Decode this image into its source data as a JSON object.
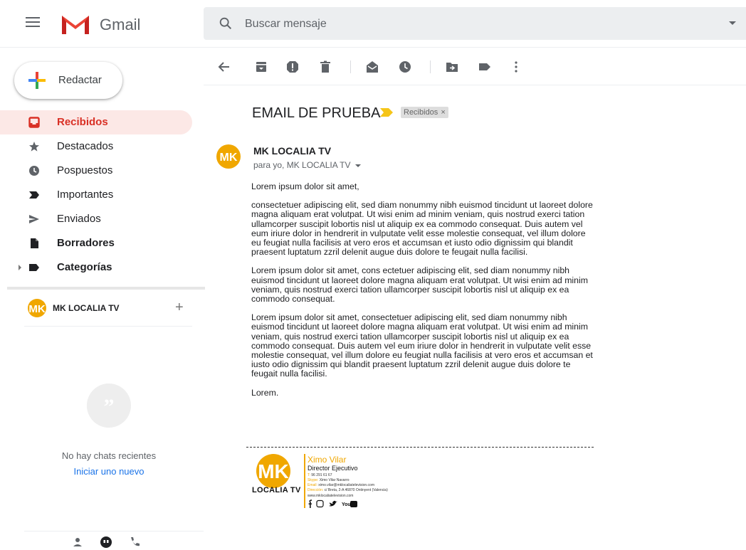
{
  "app": {
    "name": "Gmail"
  },
  "search": {
    "placeholder": "Buscar mensaje"
  },
  "compose": {
    "label": "Redactar"
  },
  "nav": [
    {
      "label": "Recibidos",
      "icon": "inbox-icon",
      "active": true
    },
    {
      "label": "Destacados",
      "icon": "star-icon"
    },
    {
      "label": "Pospuestos",
      "icon": "clock-icon"
    },
    {
      "label": "Importantes",
      "icon": "important-icon"
    },
    {
      "label": "Enviados",
      "icon": "send-icon"
    },
    {
      "label": "Borradores",
      "icon": "draft-icon"
    },
    {
      "label": "Categorías",
      "icon": "label-icon"
    }
  ],
  "account": {
    "name": "MK LOCALIA TV",
    "add": "+"
  },
  "chats": {
    "empty": "No hay chats recientes",
    "start": "Iniciar uno nuevo"
  },
  "toolbar": {
    "icons": [
      "back-arrow-icon",
      "archive-icon",
      "report-spam-icon",
      "delete-icon",
      "mark-unread-icon",
      "snooze-icon",
      "move-to-icon",
      "labels-icon",
      "more-icon"
    ]
  },
  "email": {
    "subject": "EMAIL DE PRUEBA",
    "label_chip": "Recibidos",
    "label_chip_close": "×",
    "sender": "MK LOCALIA TV",
    "recipient": "para yo, MK LOCALIA TV",
    "greeting": "Lorem ipsum dolor sit amet,",
    "para1": "consectetuer adipiscing elit, sed diam nonummy nibh euismod tincidunt ut laoreet dolore magna aliquam erat volutpat. Ut wisi enim ad minim veniam, quis nostrud exerci tation ullamcorper suscipit lobortis nisl ut aliquip ex ea commodo consequat. Duis autem vel eum iriure dolor in hendrerit in vulputate velit esse molestie consequat, vel illum dolore eu feugiat nulla facilisis at vero eros et accumsan et iusto odio dignissim qui blandit praesent luptatum zzril delenit augue duis dolore te feugait nulla facilisi.",
    "para2": "Lorem ipsum dolor sit amet, cons ectetuer adipiscing elit, sed diam nonummy nibh euismod tincidunt ut laoreet dolore magna aliquam erat volutpat. Ut wisi enim ad minim veniam, quis nostrud exerci tation ullamcorper suscipit lobortis nisl ut aliquip ex ea commodo consequat.",
    "para3": "Lorem ipsum dolor sit amet, consectetuer adipiscing elit, sed diam nonummy nibh euismod tincidunt ut laoreet dolore magna aliquam erat volutpat. Ut wisi enim ad minim veniam, quis nostrud exerci tation ullamcorper suscipit lobortis nisl ut aliquip ex ea commodo consequat. Duis autem vel eum iriure dolor in hendrerit in vulputate velit esse molestie consequat, vel illum dolore eu feugiat nulla facilisis at vero eros et accumsan et iusto odio dignissim qui blandit praesent luptatum zzril delenit augue duis dolore te feugait nulla facilisi.",
    "closing": "Lorem."
  },
  "signature": {
    "logo_text": "LOCALIA TV",
    "name": "Ximo Vilar",
    "role": "Director Ejecutivo",
    "phone_key": "T:",
    "phone": "96 291 61 67",
    "skype_key": "Skype:",
    "skype": "Ximo Vilar Navarro",
    "email_key": "Email:",
    "email": "ximo.vilar@mklocaliatelevision.com",
    "address_key": "Dirección:",
    "address": "c/ Breta, 2-A 46870 Ontinyent (Valencia)",
    "website": "www.mklocaliatelevision.com"
  },
  "colors": {
    "accent_red": "#d93025",
    "active_bg": "#fce8e6",
    "brand_orange": "#f0a700",
    "link_blue": "#1a73e8"
  }
}
